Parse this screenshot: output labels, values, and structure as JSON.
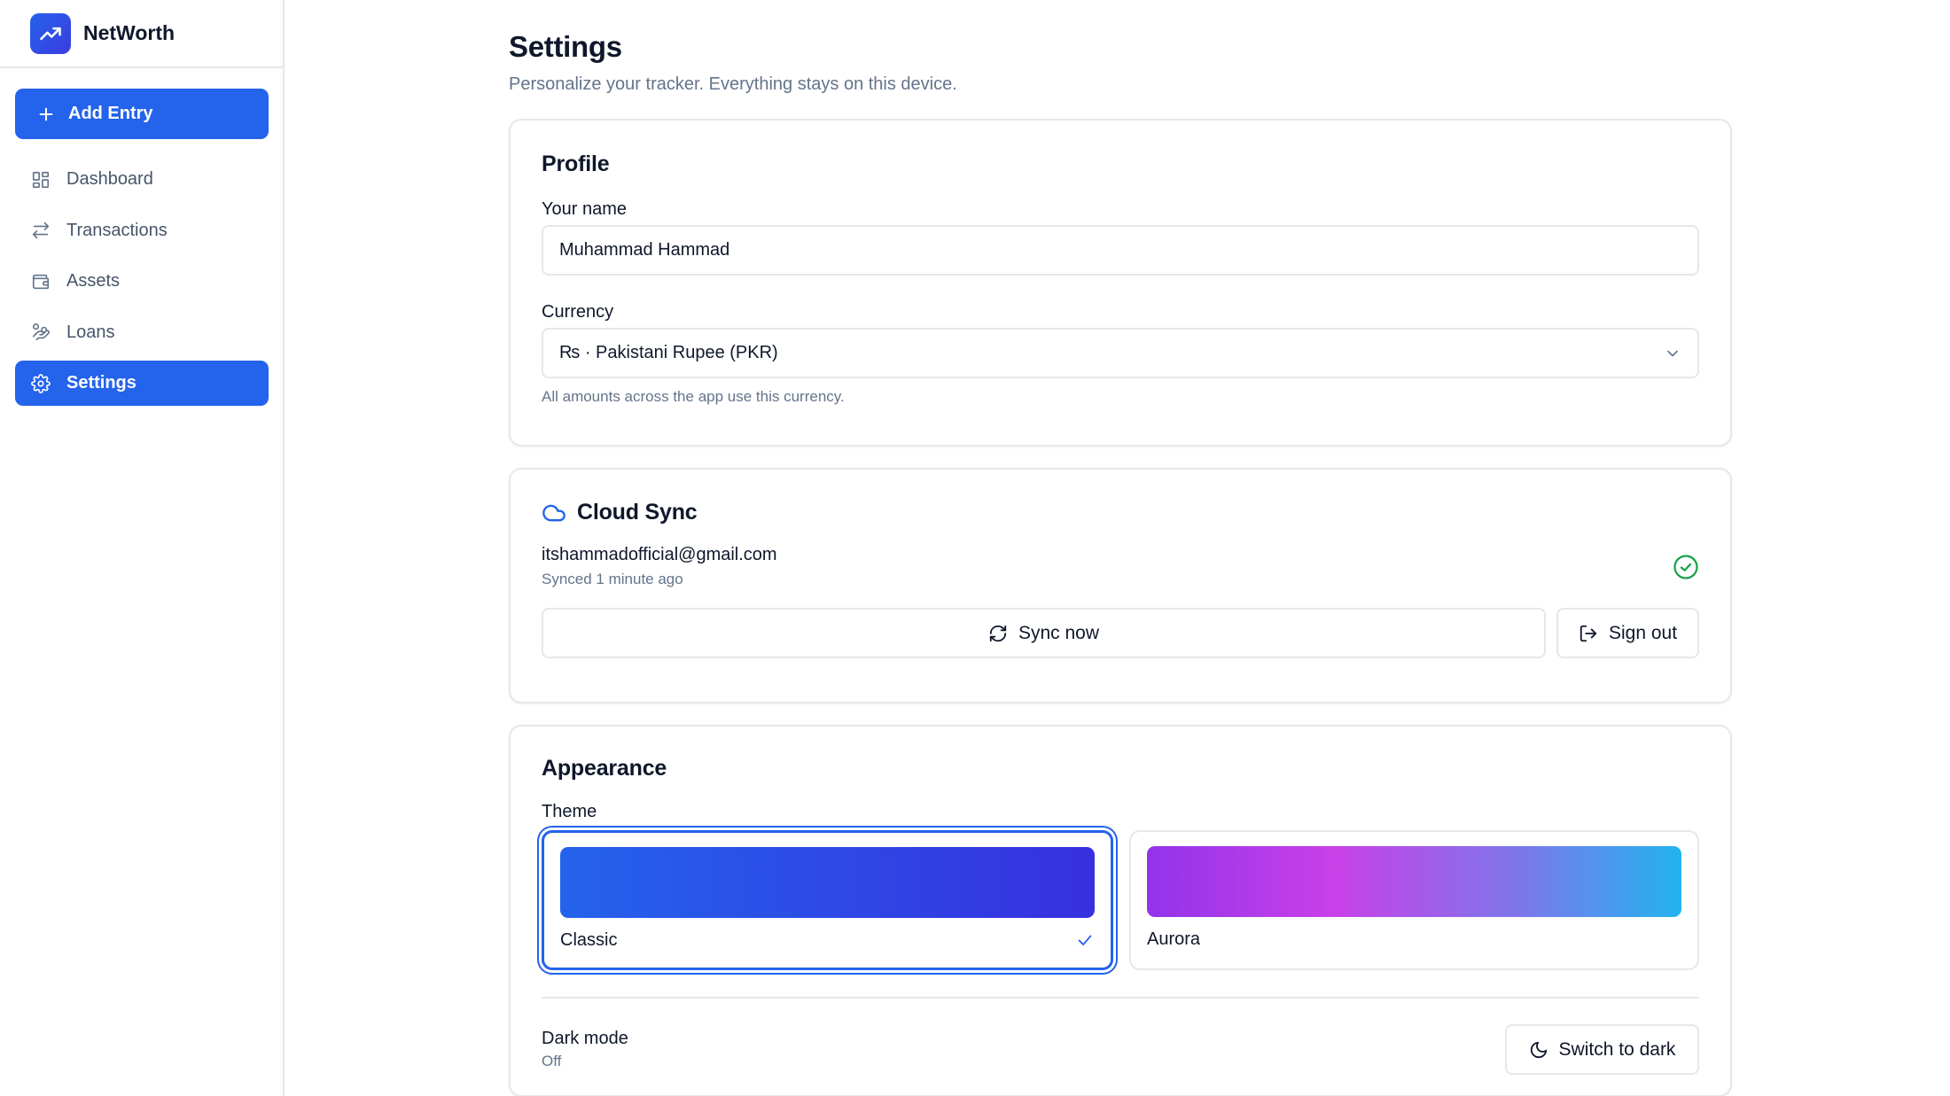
{
  "brand": {
    "name": "NetWorth",
    "icon": "trending-up-icon"
  },
  "sidebar": {
    "add_entry_label": "Add Entry",
    "items": [
      {
        "label": "Dashboard",
        "icon": "dashboard-icon",
        "active": false
      },
      {
        "label": "Transactions",
        "icon": "arrows-swap-icon",
        "active": false
      },
      {
        "label": "Assets",
        "icon": "wallet-icon",
        "active": false
      },
      {
        "label": "Loans",
        "icon": "hand-coins-icon",
        "active": false
      },
      {
        "label": "Settings",
        "icon": "gear-icon",
        "active": true
      }
    ]
  },
  "page": {
    "title": "Settings",
    "subtitle": "Personalize your tracker. Everything stays on this device."
  },
  "profile": {
    "title": "Profile",
    "name_label": "Your name",
    "name_value": "Muhammad Hammad",
    "currency_label": "Currency",
    "currency_value": "₨ · Pakistani Rupee (PKR)",
    "currency_hint": "All amounts across the app use this currency."
  },
  "cloud_sync": {
    "title": "Cloud Sync",
    "email": "itshammadofficial@gmail.com",
    "status": "Synced 1 minute ago",
    "sync_label": "Sync now",
    "signout_label": "Sign out"
  },
  "appearance": {
    "title": "Appearance",
    "theme_label": "Theme",
    "themes": [
      {
        "name": "Classic",
        "selected": true
      },
      {
        "name": "Aurora",
        "selected": false
      }
    ],
    "dark_mode_label": "Dark mode",
    "dark_mode_value": "Off",
    "switch_label": "Switch to dark"
  },
  "colors": {
    "accent": "#2463eb",
    "success": "#16a34a",
    "muted": "#64748b",
    "border": "#e5e7eb"
  }
}
